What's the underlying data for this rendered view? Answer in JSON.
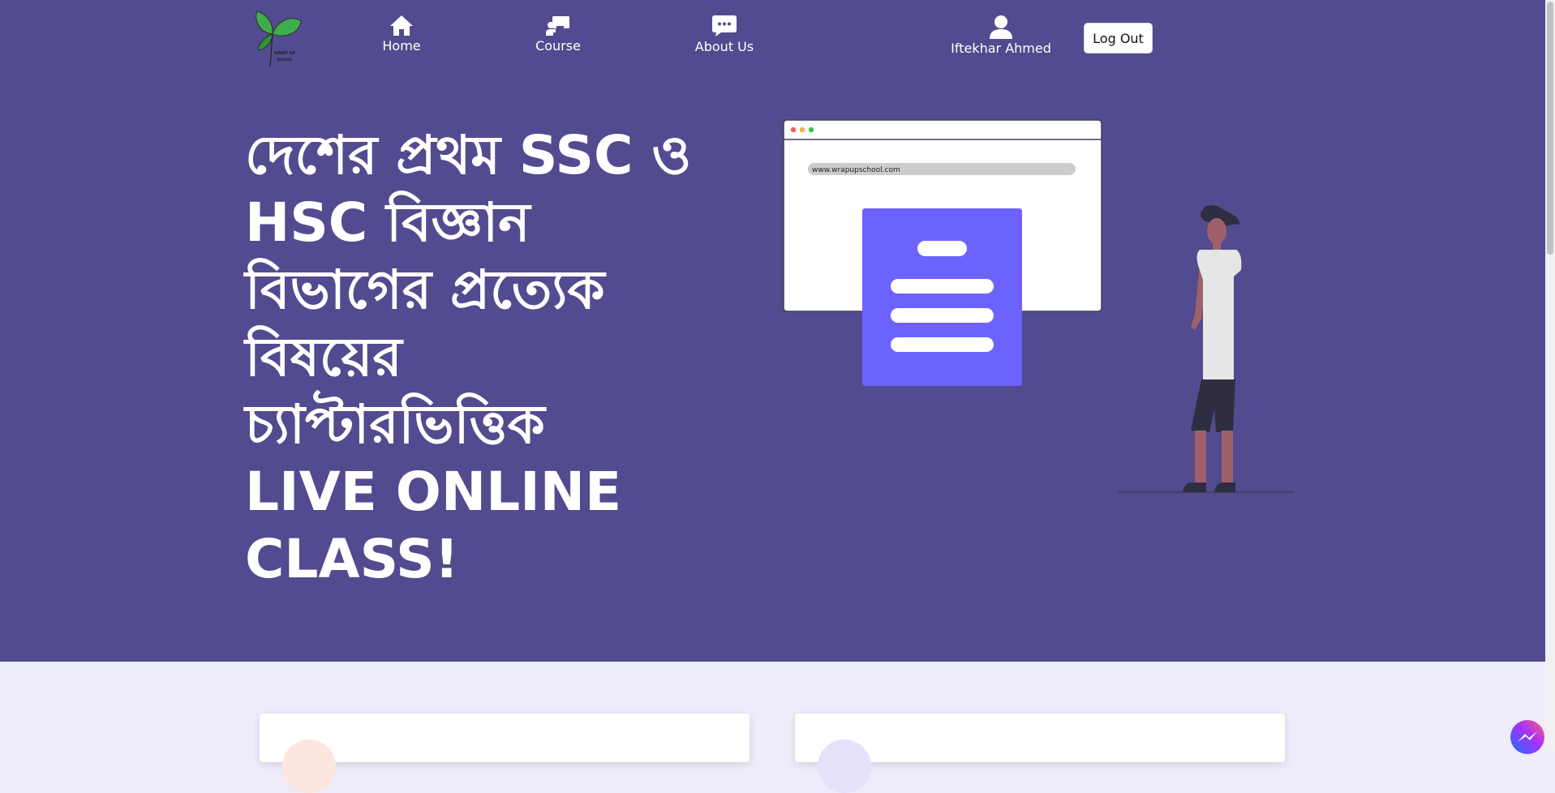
{
  "nav": {
    "logo_text_line1": "WRAP UP",
    "logo_text_line2": "SCHOOL",
    "items": [
      {
        "label": "Home",
        "icon": "home-icon"
      },
      {
        "label": "Course",
        "icon": "course-icon"
      },
      {
        "label": "About Us",
        "icon": "chat-icon"
      }
    ],
    "user_name": "Iftekhar Ahmed",
    "user_icon": "user-icon",
    "logout_label": "Log Out"
  },
  "hero": {
    "headline_lines": [
      "দেশের প্রথম SSC ও",
      "HSC বিজ্ঞান",
      "বিভাগের প্রত্যেক",
      "বিষয়ের",
      "চ্যাপ্টারভিত্তিক",
      "LIVE ONLINE",
      "CLASS!"
    ],
    "browser_url": "www.wrapupschool.com"
  },
  "colors": {
    "hero_bg": "#524b8f",
    "doc_accent": "#6c63ff",
    "page_bg": "#eeecfb"
  }
}
